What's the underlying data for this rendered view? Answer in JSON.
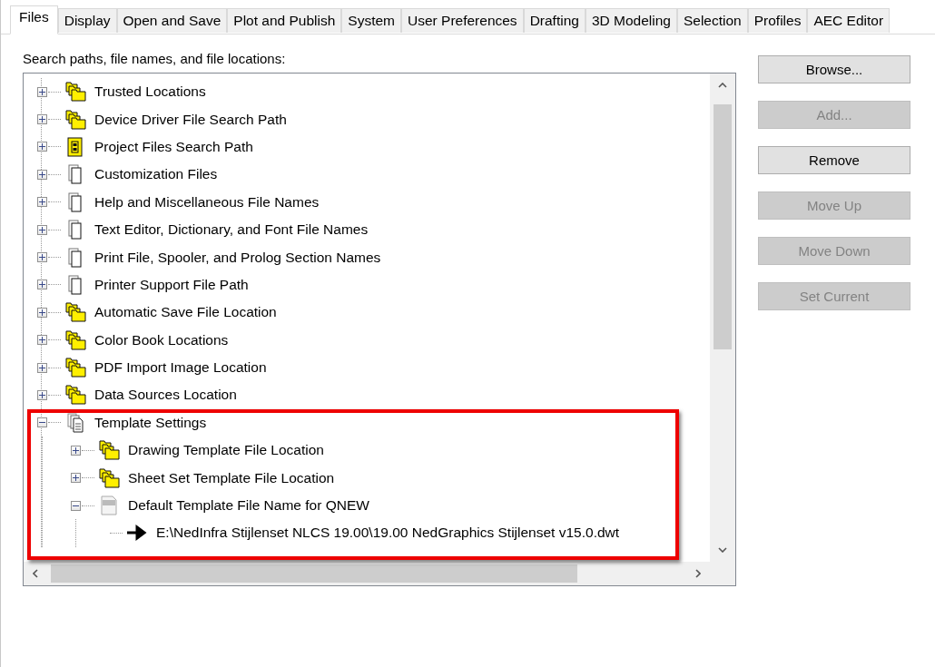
{
  "tabs": [
    {
      "label": "Files",
      "selected": true
    },
    {
      "label": "Display",
      "selected": false
    },
    {
      "label": "Open and Save",
      "selected": false
    },
    {
      "label": "Plot and Publish",
      "selected": false
    },
    {
      "label": "System",
      "selected": false
    },
    {
      "label": "User Preferences",
      "selected": false
    },
    {
      "label": "Drafting",
      "selected": false
    },
    {
      "label": "3D Modeling",
      "selected": false
    },
    {
      "label": "Selection",
      "selected": false
    },
    {
      "label": "Profiles",
      "selected": false
    },
    {
      "label": "AEC Editor",
      "selected": false
    }
  ],
  "tree_label": "Search paths, file names, and file locations:",
  "tree": [
    {
      "label": "Trusted Locations",
      "kind": "folder",
      "expanded": false
    },
    {
      "label": "Device Driver File Search Path",
      "kind": "folder",
      "expanded": false
    },
    {
      "label": "Project Files Search Path",
      "kind": "project",
      "expanded": false
    },
    {
      "label": "Customization Files",
      "kind": "files",
      "expanded": false
    },
    {
      "label": "Help and Miscellaneous File Names",
      "kind": "files",
      "expanded": false
    },
    {
      "label": "Text Editor, Dictionary, and Font File Names",
      "kind": "files",
      "expanded": false
    },
    {
      "label": "Print File, Spooler, and Prolog Section Names",
      "kind": "files",
      "expanded": false
    },
    {
      "label": "Printer Support File Path",
      "kind": "files",
      "expanded": false
    },
    {
      "label": "Automatic Save File Location",
      "kind": "folder",
      "expanded": false
    },
    {
      "label": "Color Book Locations",
      "kind": "folder",
      "expanded": false
    },
    {
      "label": "PDF Import Image Location",
      "kind": "folder",
      "expanded": false
    },
    {
      "label": "Data Sources Location",
      "kind": "folder",
      "expanded": false
    },
    {
      "label": "Template Settings",
      "kind": "group",
      "expanded": true,
      "children": [
        {
          "label": "Drawing Template File Location",
          "kind": "folder",
          "expanded": false
        },
        {
          "label": "Sheet Set Template File Location",
          "kind": "folder",
          "expanded": false
        },
        {
          "label": "Default Template File Name for QNEW",
          "kind": "template",
          "expanded": true,
          "children": [
            {
              "label": "E:\\NedInfra Stijlenset NLCS 19.00\\19.00 NedGraphics Stijlenset v15.0.dwt",
              "kind": "value"
            }
          ]
        }
      ]
    }
  ],
  "buttons": [
    {
      "label": "Browse...",
      "disabled": false
    },
    {
      "label": "Add...",
      "disabled": true
    },
    {
      "label": "Remove",
      "disabled": false
    },
    {
      "label": "Move Up",
      "disabled": true
    },
    {
      "label": "Move Down",
      "disabled": true
    },
    {
      "label": "Set Current",
      "disabled": true
    }
  ]
}
